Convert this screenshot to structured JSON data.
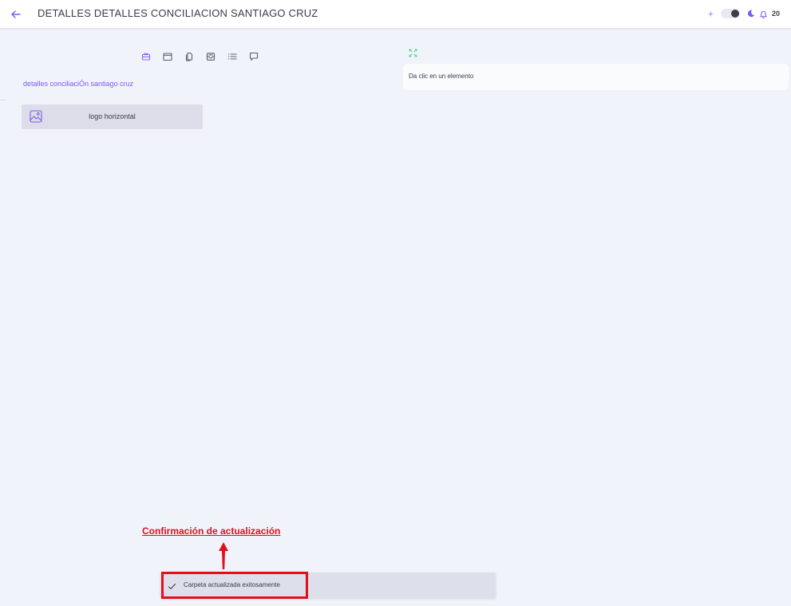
{
  "header": {
    "title": "DETALLES DETALLES CONCILIACION SANTIAGO CRUZ",
    "notification_count": "20"
  },
  "left_panel": {
    "folder_label": "detalles conciliaciÓn santiago cruz",
    "elements": [
      {
        "label": "logo horizontal",
        "icon": "image-icon"
      }
    ],
    "toolbar_icons": [
      "briefcase-icon",
      "folder-icon",
      "files-icon",
      "archive-icon",
      "list-icon",
      "comment-icon"
    ]
  },
  "right_panel": {
    "info_text": "Da clic en un elemento"
  },
  "annotation": {
    "label": "Confirmación de actualización"
  },
  "toast": {
    "message": "Carpeta actualizada exitosamente"
  },
  "colors": {
    "accent": "#7a5cf0",
    "background": "#f1f3fb",
    "annotation_red": "#e0111a",
    "expand_green": "#4fcf8e"
  }
}
